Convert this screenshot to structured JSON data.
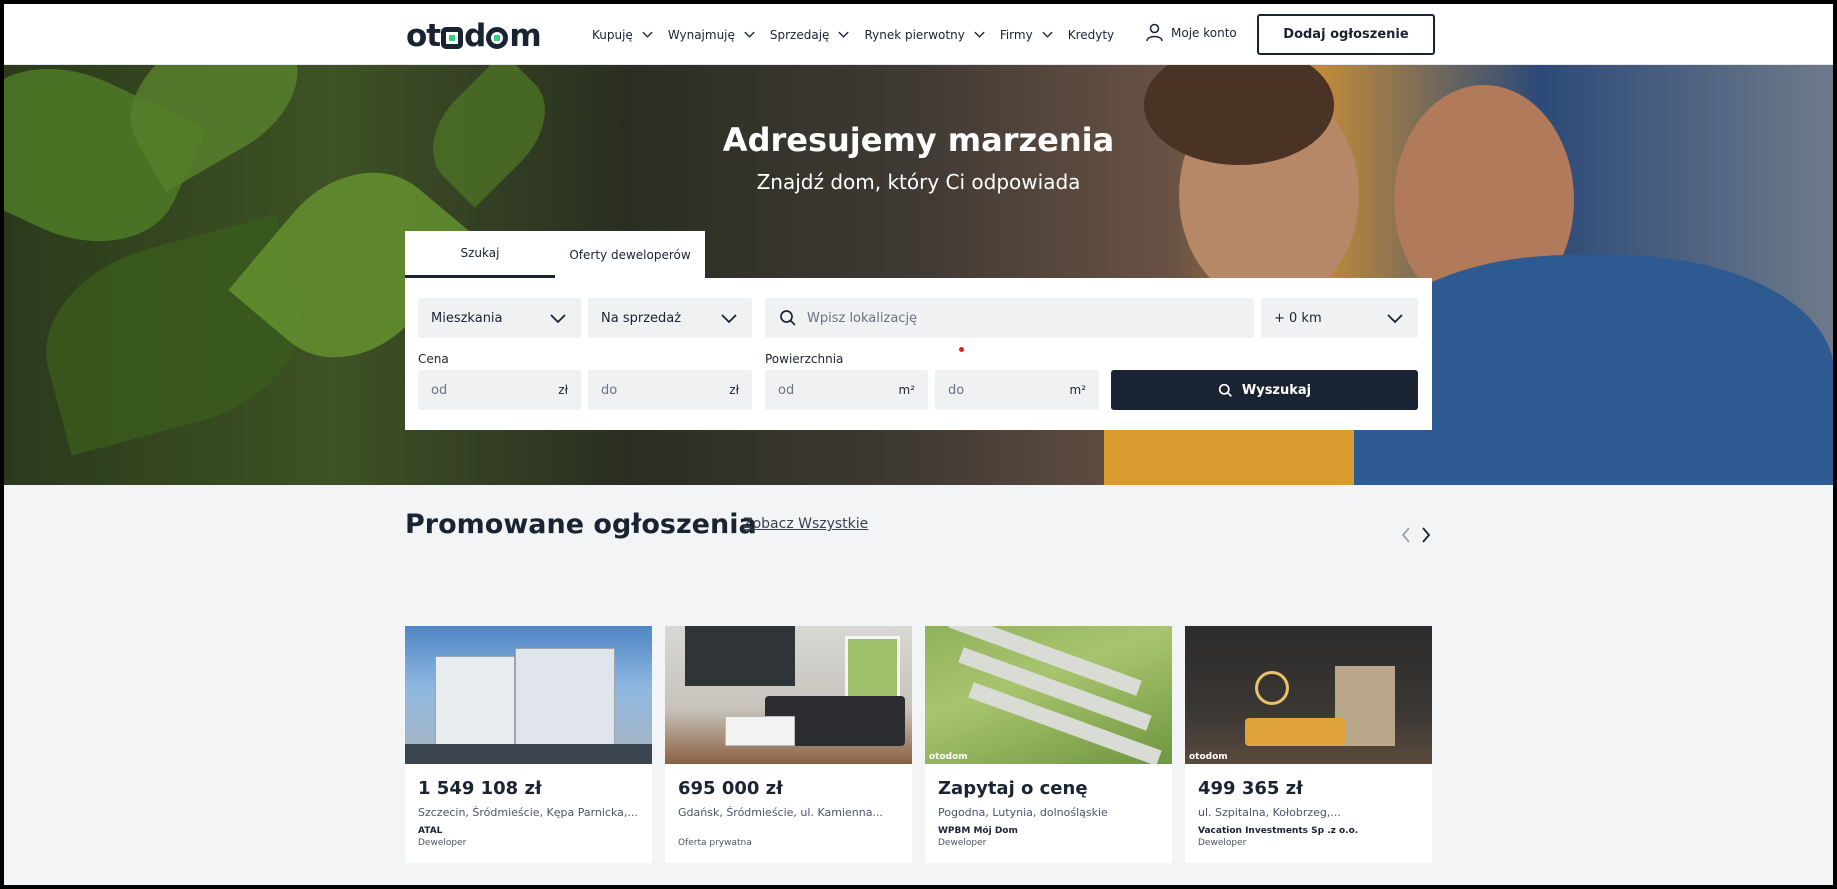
{
  "header": {
    "logo": "otodom",
    "nav": [
      "Kupuję",
      "Wynajmuję",
      "Sprzedaję",
      "Rynek pierwotny",
      "Firmy",
      "Kredyty"
    ],
    "account_label": "Moje konto",
    "add_button": "Dodaj ogłoszenie"
  },
  "hero": {
    "title": "Adresujemy marzenia",
    "subtitle": "Znajdź dom, który Ci odpowiada"
  },
  "search": {
    "tabs": [
      "Szukaj",
      "Oferty deweloperów"
    ],
    "property_type": "Mieszkania",
    "transaction": "Na sprzedaż",
    "location_placeholder": "Wpisz lokalizację",
    "distance": "+ 0 km",
    "price_label": "Cena",
    "area_label": "Powierzchnia",
    "from_placeholder": "od",
    "to_placeholder": "do",
    "currency_unit": "zł",
    "area_unit": "m²",
    "submit": "Wyszukaj"
  },
  "promoted": {
    "title": "Promowane ogłoszenia",
    "see_all": "Zobacz Wszystkie",
    "cards": [
      {
        "price": "1 549 108 zł",
        "location": "Szczecin, Śródmieście, Kępa Parnicka,...",
        "agency": "ATAL",
        "type": "Deweloper",
        "watermark": ""
      },
      {
        "price": "695 000 zł",
        "location": "Gdańsk, Śródmieście, ul. Kamienna...",
        "agency": "",
        "type": "Oferta prywatna",
        "watermark": ""
      },
      {
        "price": "Zapytaj o cenę",
        "location": "Pogodna, Lutynia, dolnośląskie",
        "agency": "WPBM Mój Dom",
        "type": "Deweloper",
        "watermark": "otodom"
      },
      {
        "price": "499 365 zł",
        "location": "ul. Szpitalna, Kołobrzeg,...",
        "agency": "Vacation Investments Sp .z o.o.",
        "type": "Deweloper",
        "watermark": "otodom"
      }
    ]
  },
  "colors": {
    "brand_dark": "#1a2332",
    "brand_green": "#2fd37e",
    "page_bg": "#f3f4f6"
  }
}
